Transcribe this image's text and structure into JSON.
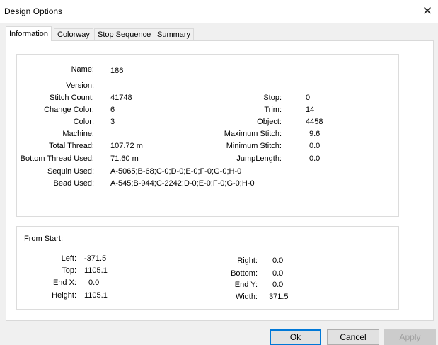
{
  "window": {
    "title": "Design Options"
  },
  "tabs": [
    {
      "label": "Information"
    },
    {
      "label": "Colorway"
    },
    {
      "label": "Stop Sequence"
    },
    {
      "label": "Summary"
    }
  ],
  "info": {
    "name_label": "Name:",
    "name_value": "186",
    "version_label": "Version:",
    "version_value": "",
    "stitch_count_label": "Stitch Count:",
    "stitch_count_value": "41748",
    "change_color_label": "Change Color:",
    "change_color_value": "6",
    "color_label": "Color:",
    "color_value": "3",
    "machine_label": "Machine:",
    "machine_value": "",
    "total_thread_label": "Total Thread:",
    "total_thread_value": "107.72 m",
    "bottom_thread_label": "Bottom Thread Used:",
    "bottom_thread_value": "71.60 m",
    "sequin_label": "Sequin Used:",
    "sequin_value": "A-5065;B-68;C-0;D-0;E-0;F-0;G-0;H-0",
    "bead_label": "Bead Used:",
    "bead_value": "A-545;B-944;C-2242;D-0;E-0;F-0;G-0;H-0",
    "stop_label": "Stop:",
    "stop_value": "0",
    "trim_label": "Trim:",
    "trim_value": "14",
    "object_label": "Object:",
    "object_value": "4458",
    "max_stitch_label": "Maximum Stitch:",
    "max_stitch_value": "9.6",
    "min_stitch_label": "Minimum Stitch:",
    "min_stitch_value": "0.0",
    "jump_length_label": "JumpLength:",
    "jump_length_value": "0.0"
  },
  "from_start": {
    "heading": "From Start:",
    "left_label": "Left:",
    "left_value": "-371.5",
    "top_label": "Top:",
    "top_value": "1105.1",
    "endx_label": "End X:",
    "endx_value": "0.0",
    "height_label": "Height:",
    "height_value": "1105.1",
    "right_label": "Right:",
    "right_value": "0.0",
    "bottom_label": "Bottom:",
    "bottom_value": "0.0",
    "endy_label": "End Y:",
    "endy_value": "0.0",
    "width_label": "Width:",
    "width_value": "371.5"
  },
  "buttons": {
    "ok": "Ok",
    "cancel": "Cancel",
    "apply": "Apply"
  },
  "icons": {
    "close": "close-icon"
  }
}
